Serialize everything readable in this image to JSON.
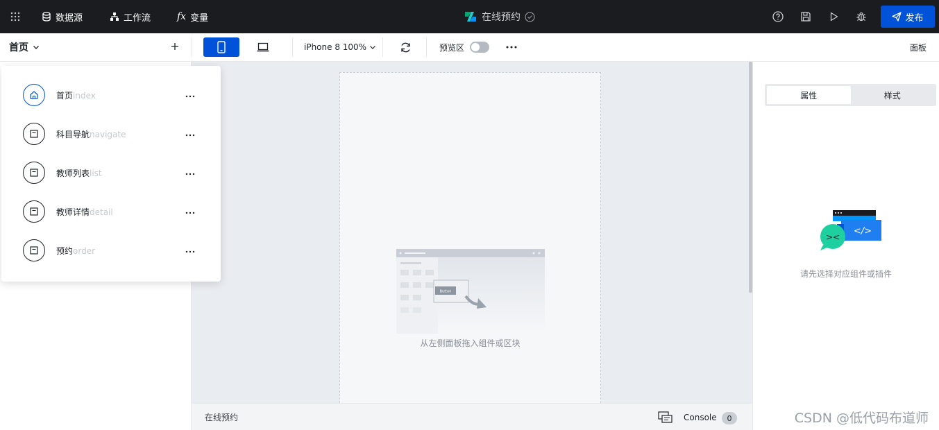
{
  "topbar": {
    "grid_icon": "apps-grid-icon",
    "datasource_label": "数据源",
    "workflow_label": "工作流",
    "variable_label": "变量",
    "app_title": "在线预约",
    "publish_label": "发布"
  },
  "toolbar": {
    "current_page": "首页",
    "device": "iPhone 8 100%",
    "preview_label": "预览区",
    "panel_label": "面板"
  },
  "pages": [
    {
      "name": "首页",
      "key": "index",
      "icon": "home-icon",
      "active": true
    },
    {
      "name": "科目导航",
      "key": "navigate",
      "icon": "page-icon",
      "active": false
    },
    {
      "name": "教师列表",
      "key": "list",
      "icon": "page-icon",
      "active": false
    },
    {
      "name": "教师详情",
      "key": "detail",
      "icon": "page-icon",
      "active": false
    },
    {
      "name": "预约",
      "key": "order",
      "icon": "page-icon",
      "active": false
    }
  ],
  "canvas": {
    "drop_hint": "从左侧面板拖入组件或区块",
    "illus_button_label": "Button"
  },
  "statusbar": {
    "app_title": "在线预约",
    "console_label": "Console",
    "console_count": "0"
  },
  "right_panel": {
    "tab_props": "属性",
    "tab_style": "样式",
    "empty_text": "请先选择对应组件或插件",
    "code_glyph": "</>",
    "chat_glyph": "><"
  },
  "watermark": "CSDN @低代码布道师",
  "colors": {
    "accent": "#0052d9",
    "topbar_bg": "#1b1c1f",
    "canvas_bg": "#e9ecf1"
  }
}
